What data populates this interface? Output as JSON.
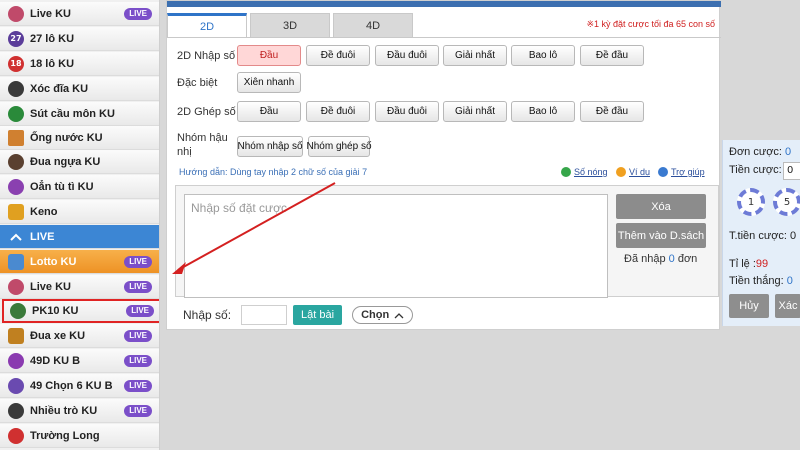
{
  "sidebar": {
    "items": [
      {
        "label": "Live KU",
        "badge": "LIVE",
        "icon": "live-person-icon",
        "color": "#c04a6a"
      },
      {
        "label": "27 lô KU",
        "badge": "",
        "icon": "badge-27-icon",
        "color": "#5b3d9a",
        "glyph": "27"
      },
      {
        "label": "18 lô KU",
        "badge": "",
        "icon": "badge-18-icon",
        "color": "#d03030",
        "glyph": "18"
      },
      {
        "label": "Xóc đĩa KU",
        "badge": "",
        "icon": "dice-icon",
        "color": "#3a3a3a"
      },
      {
        "label": "Sút cầu môn KU",
        "badge": "",
        "icon": "soccer-icon",
        "color": "#2a8a3a"
      },
      {
        "label": "Ống nước KU",
        "badge": "",
        "icon": "pipe-icon",
        "color": "#d08030"
      },
      {
        "label": "Đua ngựa KU",
        "badge": "",
        "icon": "horse-icon",
        "color": "#5a4030"
      },
      {
        "label": "Oẳn tù tì KU",
        "badge": "",
        "icon": "hand-icon",
        "color": "#8a40b0"
      },
      {
        "label": "Keno",
        "badge": "",
        "icon": "keno-icon",
        "color": "#e0a020"
      }
    ],
    "live_header": "LIVE",
    "live_items": [
      {
        "label": "Lotto KU",
        "badge": "LIVE",
        "icon": "lotto-icon",
        "color": "#4a8ad0"
      },
      {
        "label": "Live KU",
        "badge": "LIVE",
        "icon": "live-person-icon",
        "color": "#c04a6a"
      },
      {
        "label": "PK10 KU",
        "badge": "LIVE",
        "icon": "race-car-icon",
        "color": "#3a7a3a"
      },
      {
        "label": "Đua xe KU",
        "badge": "LIVE",
        "icon": "car-icon",
        "color": "#c08020"
      },
      {
        "label": "49D KU B",
        "badge": "LIVE",
        "icon": "balloon-icon",
        "color": "#8a3ab0"
      },
      {
        "label": "49 Chọn 6 KU B",
        "badge": "LIVE",
        "icon": "balls-icon",
        "color": "#6a4ab0"
      },
      {
        "label": "Nhiều trò KU",
        "badge": "LIVE",
        "icon": "games-icon",
        "color": "#3a3a3a"
      },
      {
        "label": "Trường Long",
        "badge": "",
        "icon": "dragon-icon",
        "color": "#d03030"
      }
    ]
  },
  "tabs": [
    {
      "label": "2D"
    },
    {
      "label": "3D"
    },
    {
      "label": "4D"
    }
  ],
  "tab_note": "※1 kỳ đặt cược tối đa 65 con số",
  "rows": {
    "nhap_so": {
      "label": "2D Nhập số",
      "buttons": [
        "Đầu",
        "Đề đuôi",
        "Đầu đuôi",
        "Giải nhất",
        "Bao lô",
        "Đề đầu"
      ]
    },
    "dac_biet": {
      "label": "Đặc biệt",
      "buttons": [
        "Xiên nhanh"
      ]
    },
    "ghep_so": {
      "label": "2D Ghép số",
      "buttons": [
        "Đầu",
        "Đề đuôi",
        "Đầu đuôi",
        "Giải nhất",
        "Bao lô",
        "Đề đầu"
      ]
    },
    "nhom": {
      "label_1": "Nhóm hậu",
      "label_2": "nhị",
      "buttons": [
        "Nhóm nhập số",
        "Nhóm ghép số"
      ]
    }
  },
  "guide": "Hướng dẫn: Dùng tay nhập 2 chữ số của giải 7",
  "tools": {
    "hot": "Số nóng",
    "example": "Ví dụ",
    "help": "Trợ giúp"
  },
  "entry": {
    "placeholder": "Nhập số đặt cược",
    "delete_label": "Xóa",
    "add_list_label": "Thêm vào D.sách",
    "imported_prefix": "Đã nhập",
    "imported_count": "0",
    "imported_suffix": "đơn"
  },
  "bottom": {
    "label": "Nhập số:",
    "flip_label": "Lật bài",
    "choose_label": "Chọn"
  },
  "bet_panel": {
    "order_label": "Đơn cược:",
    "order_value": "0",
    "bet_label": "Tiền cược:",
    "bet_value": "0",
    "chips": [
      "1",
      "5"
    ],
    "total_label": "T.tiền cược:",
    "total_value": "0",
    "odds_label": "Tỉ lệ :",
    "odds_value": "99",
    "win_label": "Tiền thắng:",
    "win_value": "0",
    "cancel_label": "Hủy",
    "confirm_label": "Xác"
  }
}
